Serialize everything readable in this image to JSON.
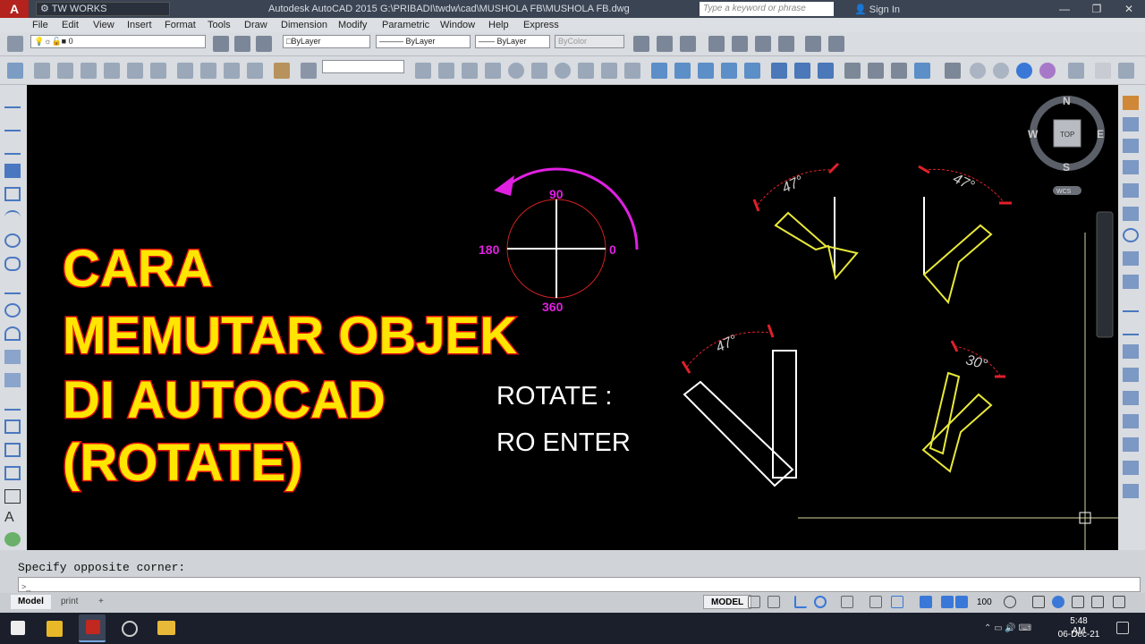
{
  "titlebar": {
    "logo": "A",
    "workspace": "TW WORKS",
    "app_title": "Autodesk AutoCAD 2015",
    "file_path": "G:\\PRIBADI\\twdw\\cad\\MUSHOLA FB\\MUSHOLA FB.dwg",
    "search_placeholder": "Type a keyword or phrase",
    "sign_in": "Sign In",
    "minimize": "—",
    "maximize": "❐",
    "close": "✕"
  },
  "menu": [
    "File",
    "Edit",
    "View",
    "Insert",
    "Format",
    "Tools",
    "Draw",
    "Dimension",
    "Modify",
    "Parametric",
    "Window",
    "Help",
    "Express"
  ],
  "toolbar": {
    "layer_value": "0",
    "color_value": "ByLayer",
    "linetype_value": "ByLayer",
    "lineweight_value": "ByLayer",
    "plotstyle_value": "ByColor"
  },
  "drawing": {
    "title_lines": [
      "CARA",
      "MEMUTAR OBJEK",
      "DI AUTOCAD",
      "(ROTATE)"
    ],
    "compass_labels": {
      "top": "90",
      "left": "180",
      "right": "0",
      "bottom": "360"
    },
    "instruction_line1": "ROTATE :",
    "instruction_line2": "RO ENTER",
    "angle_labels": [
      "47°",
      "47°",
      "47°",
      "30°"
    ],
    "viewcube": {
      "north": "N",
      "south": "S",
      "east": "E",
      "west": "W",
      "face": "TOP",
      "ucs": "WCS"
    },
    "colors": {
      "yellow_shape": "#e8e83a",
      "red_dim": "#e0202a",
      "magenta_arrow": "#e020e0",
      "title_fill": "#ffe600",
      "title_stroke": "#e01010"
    }
  },
  "command": {
    "history": "Specify opposite corner:",
    "prompt_icon": ">_"
  },
  "layout_tabs": [
    "Model",
    "print",
    "+"
  ],
  "status": {
    "model_label": "MODEL",
    "scale": "100"
  },
  "taskbar": {
    "time": "5:48 AM",
    "date": "06-Dec-21"
  }
}
